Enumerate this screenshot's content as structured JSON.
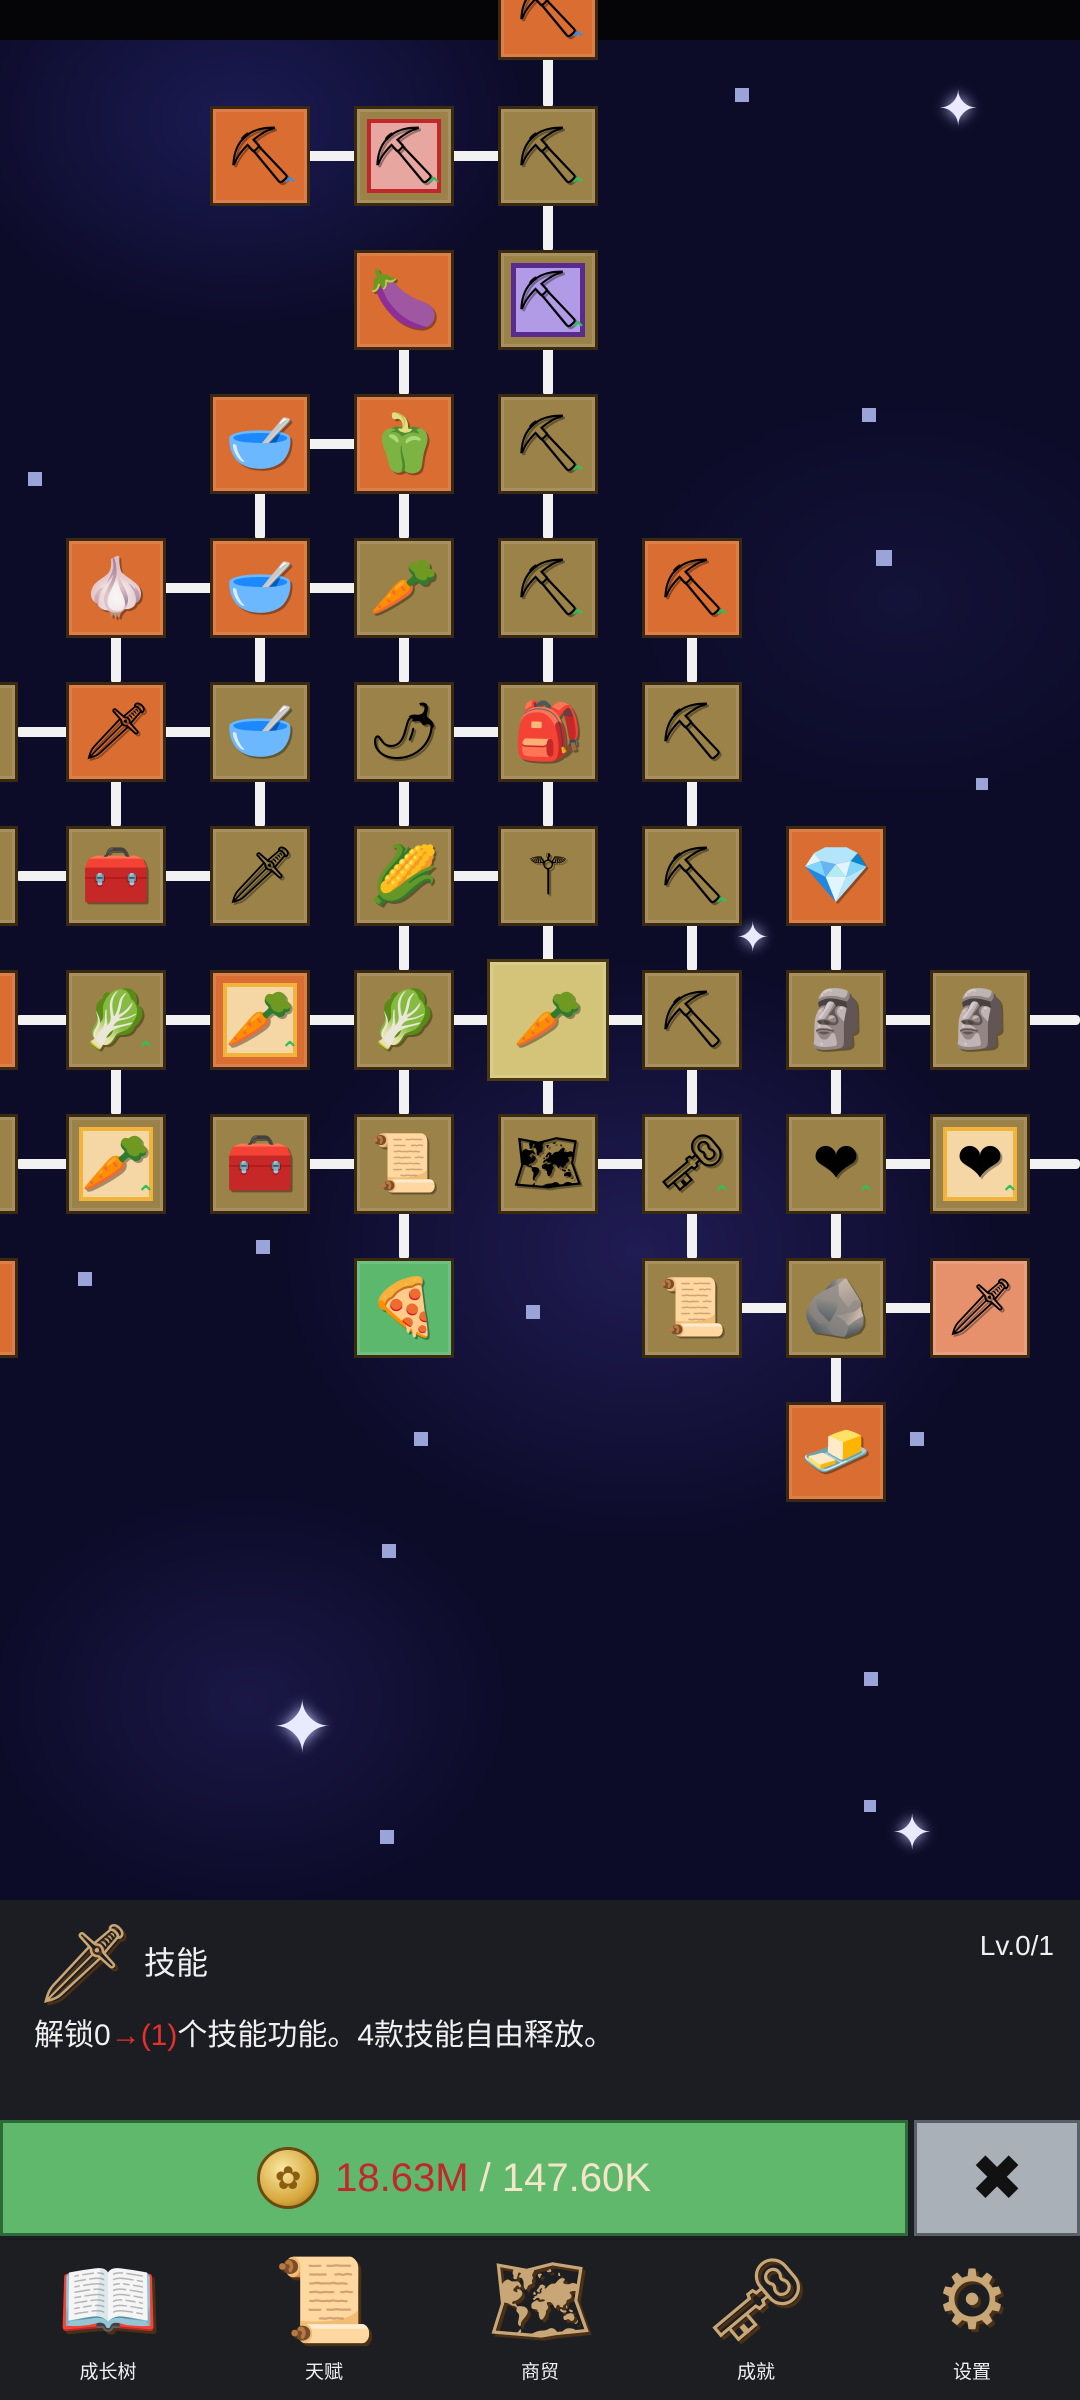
{
  "tree": {
    "nodes": [
      {
        "id": "n0",
        "name": "shovel-upgrade-node",
        "bg": "orange",
        "icon": "⛏",
        "icon_name": "shovel-icon",
        "arrow": "blue"
      },
      {
        "id": "n1",
        "name": "shovel-upgrade-node",
        "bg": "orange",
        "icon": "⛏",
        "icon_name": "shovel-icon",
        "arrow": "blue"
      },
      {
        "id": "n2",
        "name": "shovel-upgrade-node",
        "bg": "tan",
        "frame": "red",
        "icon": "⛏",
        "icon_name": "shovel-icon",
        "arrow": "green"
      },
      {
        "id": "n3",
        "name": "shovel-upgrade-node",
        "bg": "tan",
        "icon": "⛏",
        "icon_name": "shovel-icon",
        "arrow": "green"
      },
      {
        "id": "n4",
        "name": "eggplant-node",
        "bg": "orange",
        "icon": "🍆",
        "icon_name": "eggplant-icon"
      },
      {
        "id": "n5",
        "name": "shovel-upgrade-node",
        "bg": "tan",
        "frame": "purple",
        "icon": "⛏",
        "icon_name": "shovel-icon",
        "arrow": "green"
      },
      {
        "id": "n6",
        "name": "bowl-node",
        "bg": "orange",
        "icon": "🥣",
        "icon_name": "bowl-icon"
      },
      {
        "id": "n7",
        "name": "bell-pepper-node",
        "bg": "orange",
        "icon": "🫑",
        "icon_name": "bell-pepper-icon"
      },
      {
        "id": "n8",
        "name": "shovel-upgrade-node",
        "bg": "tan",
        "icon": "⛏",
        "icon_name": "shovel-icon",
        "arrow": "green"
      },
      {
        "id": "n9",
        "name": "garlic-node",
        "bg": "orange",
        "icon": "🧄",
        "icon_name": "garlic-icon"
      },
      {
        "id": "n10",
        "name": "bowl-node",
        "bg": "orange",
        "icon": "🥣",
        "icon_name": "bowl-icon"
      },
      {
        "id": "n11",
        "name": "radish-node",
        "bg": "tan",
        "icon": "🥕",
        "icon_name": "radish-icon"
      },
      {
        "id": "n12",
        "name": "shovel-upgrade-node",
        "bg": "tan",
        "icon": "⛏",
        "icon_name": "shovel-icon",
        "arrow": "green"
      },
      {
        "id": "n13",
        "name": "pickaxe-upgrade-node",
        "bg": "orange",
        "icon": "⛏",
        "icon_name": "pickaxe-icon",
        "arrow": "green"
      },
      {
        "id": "n14",
        "name": "edge-node",
        "bg": "tan",
        "icon": "",
        "icon_name": "partial-icon"
      },
      {
        "id": "n15",
        "name": "sword-node",
        "bg": "orange",
        "icon": "🗡",
        "icon_name": "sword-icon"
      },
      {
        "id": "n16",
        "name": "bowl-node",
        "bg": "tan",
        "icon": "🥣",
        "icon_name": "bowl-icon"
      },
      {
        "id": "n17",
        "name": "chili-pepper-node",
        "bg": "tan",
        "icon": "🌶",
        "icon_name": "chili-pepper-icon"
      },
      {
        "id": "n18",
        "name": "backpack-node",
        "bg": "tan",
        "icon": "🎒",
        "icon_name": "backpack-icon"
      },
      {
        "id": "n19",
        "name": "pickaxe-upgrade-node",
        "bg": "tan",
        "icon": "⛏",
        "icon_name": "pickaxe-icon"
      },
      {
        "id": "n20",
        "name": "edge-node",
        "bg": "tan",
        "icon": "",
        "icon_name": "partial-icon"
      },
      {
        "id": "n21",
        "name": "chest-node",
        "bg": "tan",
        "icon": "🧰",
        "icon_name": "chest-icon"
      },
      {
        "id": "n22",
        "name": "sword-node",
        "bg": "tan",
        "icon": "🗡",
        "icon_name": "sword-icon"
      },
      {
        "id": "n23",
        "name": "corn-node",
        "bg": "tan",
        "icon": "🌽",
        "icon_name": "corn-icon"
      },
      {
        "id": "n24",
        "name": "wand-node",
        "bg": "tan",
        "icon": "⚚",
        "icon_name": "wand-icon"
      },
      {
        "id": "n25",
        "name": "pickaxe-upgrade-node",
        "bg": "tan",
        "icon": "⛏",
        "icon_name": "pickaxe-icon",
        "arrow": "green"
      },
      {
        "id": "n26",
        "name": "crystal-node",
        "bg": "orange",
        "icon": "💎",
        "icon_name": "crystal-icon"
      },
      {
        "id": "n27",
        "name": "edge-node",
        "bg": "orange",
        "icon": "",
        "icon_name": "partial-icon"
      },
      {
        "id": "n28",
        "name": "cabbage-node",
        "bg": "tan",
        "icon": "🥬",
        "icon_name": "cabbage-icon",
        "arrow": "green"
      },
      {
        "id": "n29",
        "name": "carrot-upgrade-node",
        "bg": "orange",
        "frame": "gold",
        "icon": "🥕",
        "icon_name": "carrot-icon",
        "arrow": "green"
      },
      {
        "id": "n30",
        "name": "cabbage-node",
        "bg": "tan",
        "icon": "🥬",
        "icon_name": "cabbage-icon"
      },
      {
        "id": "n31",
        "name": "carrot-node-selected",
        "bg": "tan",
        "selected": true,
        "icon": "🥕",
        "icon_name": "carrot-icon"
      },
      {
        "id": "n32",
        "name": "pickaxe-upgrade-node",
        "bg": "tan",
        "icon": "⛏",
        "icon_name": "pickaxe-icon"
      },
      {
        "id": "n33",
        "name": "statue-node",
        "bg": "tan",
        "icon": "🗿",
        "icon_name": "statue-icon"
      },
      {
        "id": "n34",
        "name": "statue-node",
        "bg": "tan",
        "icon": "🗿",
        "icon_name": "statue-icon"
      },
      {
        "id": "n35",
        "name": "edge-node",
        "bg": "tan",
        "icon": "",
        "icon_name": "partial-icon"
      },
      {
        "id": "n36",
        "name": "carrot-upgrade-node",
        "bg": "tan",
        "frame": "gold",
        "icon": "🥕",
        "icon_name": "carrot-icon",
        "arrow": "green"
      },
      {
        "id": "n37",
        "name": "chest-node",
        "bg": "tan",
        "icon": "🧰",
        "icon_name": "treasure-chest-icon"
      },
      {
        "id": "n38",
        "name": "scroll-node",
        "bg": "tan",
        "icon": "📜",
        "icon_name": "scroll-icon"
      },
      {
        "id": "n39",
        "name": "map-node",
        "bg": "tan",
        "icon": "🗺",
        "icon_name": "map-icon"
      },
      {
        "id": "n40",
        "name": "key-node",
        "bg": "tan",
        "icon": "🗝",
        "icon_name": "key-icon",
        "arrow": "green"
      },
      {
        "id": "n41",
        "name": "heart-node",
        "bg": "tan",
        "icon": "❤",
        "icon_name": "heart-icon",
        "arrow": "green"
      },
      {
        "id": "n42",
        "name": "heart-upgrade-node",
        "bg": "tan",
        "frame": "gold",
        "icon": "❤",
        "icon_name": "heart-icon",
        "arrow": "green"
      },
      {
        "id": "n43",
        "name": "edge-node",
        "bg": "orange",
        "icon": "",
        "icon_name": "partial-icon"
      },
      {
        "id": "n44",
        "name": "pizza-node",
        "bg": "green",
        "icon": "🍕",
        "icon_name": "pizza-icon"
      },
      {
        "id": "n45",
        "name": "scroll-node",
        "bg": "tan",
        "icon": "📜",
        "icon_name": "scroll-icon"
      },
      {
        "id": "n46",
        "name": "fossil-stone-node",
        "bg": "tan",
        "icon": "🪨",
        "icon_name": "fossil-icon"
      },
      {
        "id": "n47",
        "name": "skill-sword-node",
        "bg": "peach",
        "icon": "🗡",
        "icon_name": "sword-icon"
      },
      {
        "id": "n48",
        "name": "gold-bar-node",
        "bg": "orange",
        "icon": "🧈",
        "icon_name": "gold-bar-icon"
      }
    ]
  },
  "detail": {
    "skill_name": "技能",
    "level": "Lv.0/1",
    "desc_prefix": "解锁0",
    "desc_arrow": "→(1)",
    "desc_suffix": "个技能功能。4款技能自由释放。",
    "cost_have": "18.63M",
    "cost_sep": " / ",
    "cost_need": "147.60K",
    "coin_glyph": "✿",
    "close_glyph": "✖"
  },
  "nav": {
    "items": [
      {
        "label": "成长树",
        "icon": "📖",
        "icon_name": "growth-tree-book-icon"
      },
      {
        "label": "天赋",
        "icon": "📜",
        "icon_name": "talent-scroll-icon"
      },
      {
        "label": "商贸",
        "icon": "🗺",
        "icon_name": "trade-map-icon"
      },
      {
        "label": "成就",
        "icon": "🗝",
        "icon_name": "achievement-key-icon"
      },
      {
        "label": "设置",
        "icon": "⚙",
        "icon_name": "settings-gear-icon"
      }
    ]
  },
  "colors": {
    "orange_tile": "#d96d32",
    "tan_tile": "#9a8248",
    "green_tile": "#5cb86d",
    "buy_button": "#60b86d",
    "close_button": "#a9b0b8",
    "space_bg": "#0c0b28",
    "panel_bg": "#1b1d22",
    "cost_insufficient": "#c0282b"
  }
}
